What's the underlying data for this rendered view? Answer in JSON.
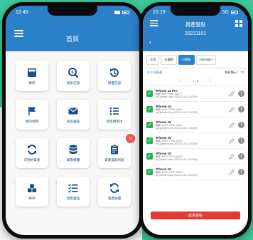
{
  "colors": {
    "brand_blue": "#2c7fc9",
    "brand_green": "#2fbf8c",
    "check_green": "#27ae60",
    "finish_red": "#e53935",
    "badge_red": "#ef5450"
  },
  "left_phone": {
    "status": {
      "time": "12:49"
    },
    "header": {
      "title": "首頁"
    },
    "tiles": [
      {
        "label": "資料",
        "icon": "card-icon"
      },
      {
        "label": "搜索記錄",
        "icon": "search-dollar-icon"
      },
      {
        "label": "歸還記錄",
        "icon": "history-icon"
      },
      {
        "label": "我的借用",
        "icon": "flag-icon"
      },
      {
        "label": "訊息通知",
        "icon": "mail-icon"
      },
      {
        "label": "須借用借出",
        "icon": "list-icon"
      },
      {
        "label": "可預約資產",
        "icon": "refresh-icon"
      },
      {
        "label": "資產總攬",
        "icon": "database-icon"
      },
      {
        "label": "資產盤點列表",
        "icon": "clipboard-icon",
        "badge": "10"
      },
      {
        "label": "庫存",
        "icon": "boxes-icon"
      },
      {
        "label": "資產盤點",
        "icon": "checklist-icon"
      },
      {
        "label": "資產歸還",
        "icon": "sync-icon"
      }
    ]
  },
  "right_phone": {
    "status": {
      "time": "15:19",
      "carrier": "5G"
    },
    "header": {
      "title": "資產盤點",
      "subtitle": "20231101",
      "back": "‹"
    },
    "tabs": [
      {
        "label": "全部",
        "active": false
      },
      {
        "label": "未盤點",
        "active": false
      },
      {
        "label": "已盤點",
        "active": true
      },
      {
        "label": "Damaged",
        "active": false
      }
    ],
    "summary": {
      "count": "共 6 項資產",
      "page_label": "每頁顯示：",
      "page_size": "20"
    },
    "pager": {
      "first": "«",
      "prev": "‹",
      "range": "1 - 6",
      "next": "›",
      "last": "»"
    },
    "items": [
      {
        "name": "iPhone 14 Pro",
        "line1": "編號: A00 / RFID: A001 /",
        "line2": "by Quentin Kam (2023-11-01 11:52:59)"
      },
      {
        "name": "iPhone 15",
        "line1": "編號: A001 / RFID: A002 /",
        "line2": "by Quentin Kam (2023-11-01 11:52:59)"
      },
      {
        "name": "iPhone 15",
        "line1": "編號: A002 / RFID: A002 /",
        "line2": "by Quentin Kam (2023-11-01 11:52:59)"
      },
      {
        "name": "iPhone 15",
        "line1": "編號: A003 / RFID: A003 /",
        "line2": "by Quentin Kam (2023-11-01 11:52:59)"
      },
      {
        "name": "iPhone 15",
        "line1": "編號: A003 / RFID: A003 /",
        "line2": "by Quentin Kam (2023-11-01 11:52:59)"
      },
      {
        "name": "iPhone 15",
        "line1": "編號: A001 / RFID: A001 /",
        "line2": "by Quentin Kam (2023-11-01 11:52:59)"
      }
    ],
    "finish_button": "結束盤點"
  }
}
